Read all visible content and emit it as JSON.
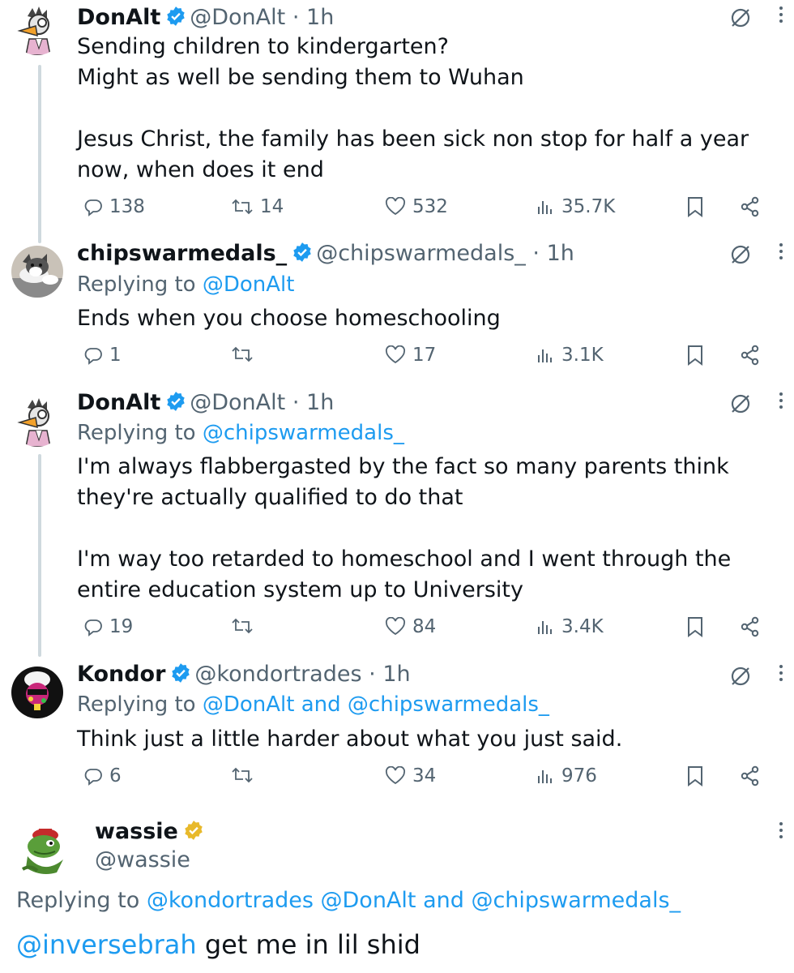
{
  "tweets": [
    {
      "name": "DonAlt",
      "handle": "@DonAlt",
      "dot": "·",
      "time": "1h",
      "reply_prefix": "",
      "reply_mentions": "",
      "text": "Sending children to kindergarten?\nMight as well be sending them to Wuhan\n\nJesus Christ, the family has been sick non stop for half a year now, when does it end",
      "replies": "138",
      "reposts": "14",
      "likes": "532",
      "views": "35.7K"
    },
    {
      "name": "chipswarmedals_",
      "handle": "@chipswarmedals_",
      "dot": "·",
      "time": "1h",
      "reply_prefix": "Replying to ",
      "reply_mentions": "@DonAlt",
      "text": "Ends when you choose homeschooling",
      "replies": "1",
      "reposts": "",
      "likes": "17",
      "views": "3.1K"
    },
    {
      "name": "DonAlt",
      "handle": "@DonAlt",
      "dot": "·",
      "time": "1h",
      "reply_prefix": "Replying to ",
      "reply_mentions": "@chipswarmedals_",
      "text": "I'm always flabbergasted by the fact so many parents think they're actually qualified to do that\n\nI'm way too retarded to homeschool and I went through the entire education system up to University",
      "replies": "19",
      "reposts": "",
      "likes": "84",
      "views": "3.4K"
    },
    {
      "name": "Kondor",
      "handle": "@kondortrades",
      "dot": "·",
      "time": "1h",
      "reply_prefix": "Replying to ",
      "reply_mentions": "@DonAlt and @chipswarmedals_",
      "text": "Think just a little harder about what you just said.",
      "replies": "6",
      "reposts": "",
      "likes": "34",
      "views": "976"
    }
  ],
  "main_tweet": {
    "name": "wassie",
    "handle": "@wassie",
    "reply_prefix": "Replying to ",
    "reply_mentions": "@kondortrades @DonAlt and @chipswarmedals_",
    "mention": "@inversebrah",
    "text": " get me in lil shid"
  },
  "colors": {
    "accent": "#1d9bf0",
    "secondary_text": "#536471",
    "verified_blue": "#1d9bf0",
    "verified_gold": "#e8b92b"
  },
  "icons": [
    "reply-icon",
    "repost-icon",
    "like-icon",
    "views-icon",
    "bookmark-icon",
    "share-icon",
    "grok-icon",
    "more-icon",
    "verified-badge-icon"
  ]
}
